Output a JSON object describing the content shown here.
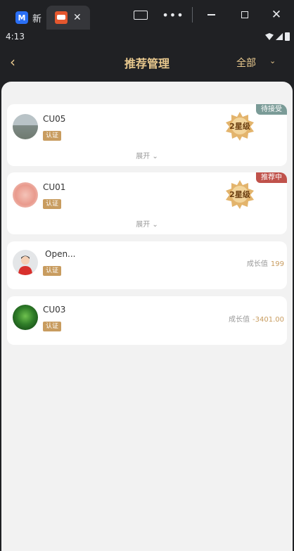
{
  "window": {
    "tabs": [
      {
        "title": "新"
      },
      {
        "title": ""
      }
    ],
    "close_glyph": "✕",
    "more_glyph": "•••"
  },
  "status_bar": {
    "time": "4:13"
  },
  "header": {
    "back_glyph": "‹",
    "title": "推荐管理",
    "filter_label": "全部",
    "filter_chevron": "⌄"
  },
  "colors": {
    "accent_gold": "#c89c5f",
    "header_gold": "#e9c98e",
    "tag_pending": "#7a9b97",
    "tag_recommending": "#c0524b"
  },
  "cards": [
    {
      "name": "CU05",
      "badge": "认证",
      "status_tag": "待接受",
      "level": "2星级",
      "expand_label": "展开"
    },
    {
      "name": "CU01",
      "badge": "认证",
      "status_tag": "推荐中",
      "level": "2星级",
      "expand_label": "展开"
    },
    {
      "name": "Open...",
      "badge": "认证",
      "growth_label": "成长值",
      "growth_value": "199"
    },
    {
      "name": "CU03",
      "badge": "认证",
      "growth_label": "成长值",
      "growth_value": "-3401.00"
    }
  ]
}
